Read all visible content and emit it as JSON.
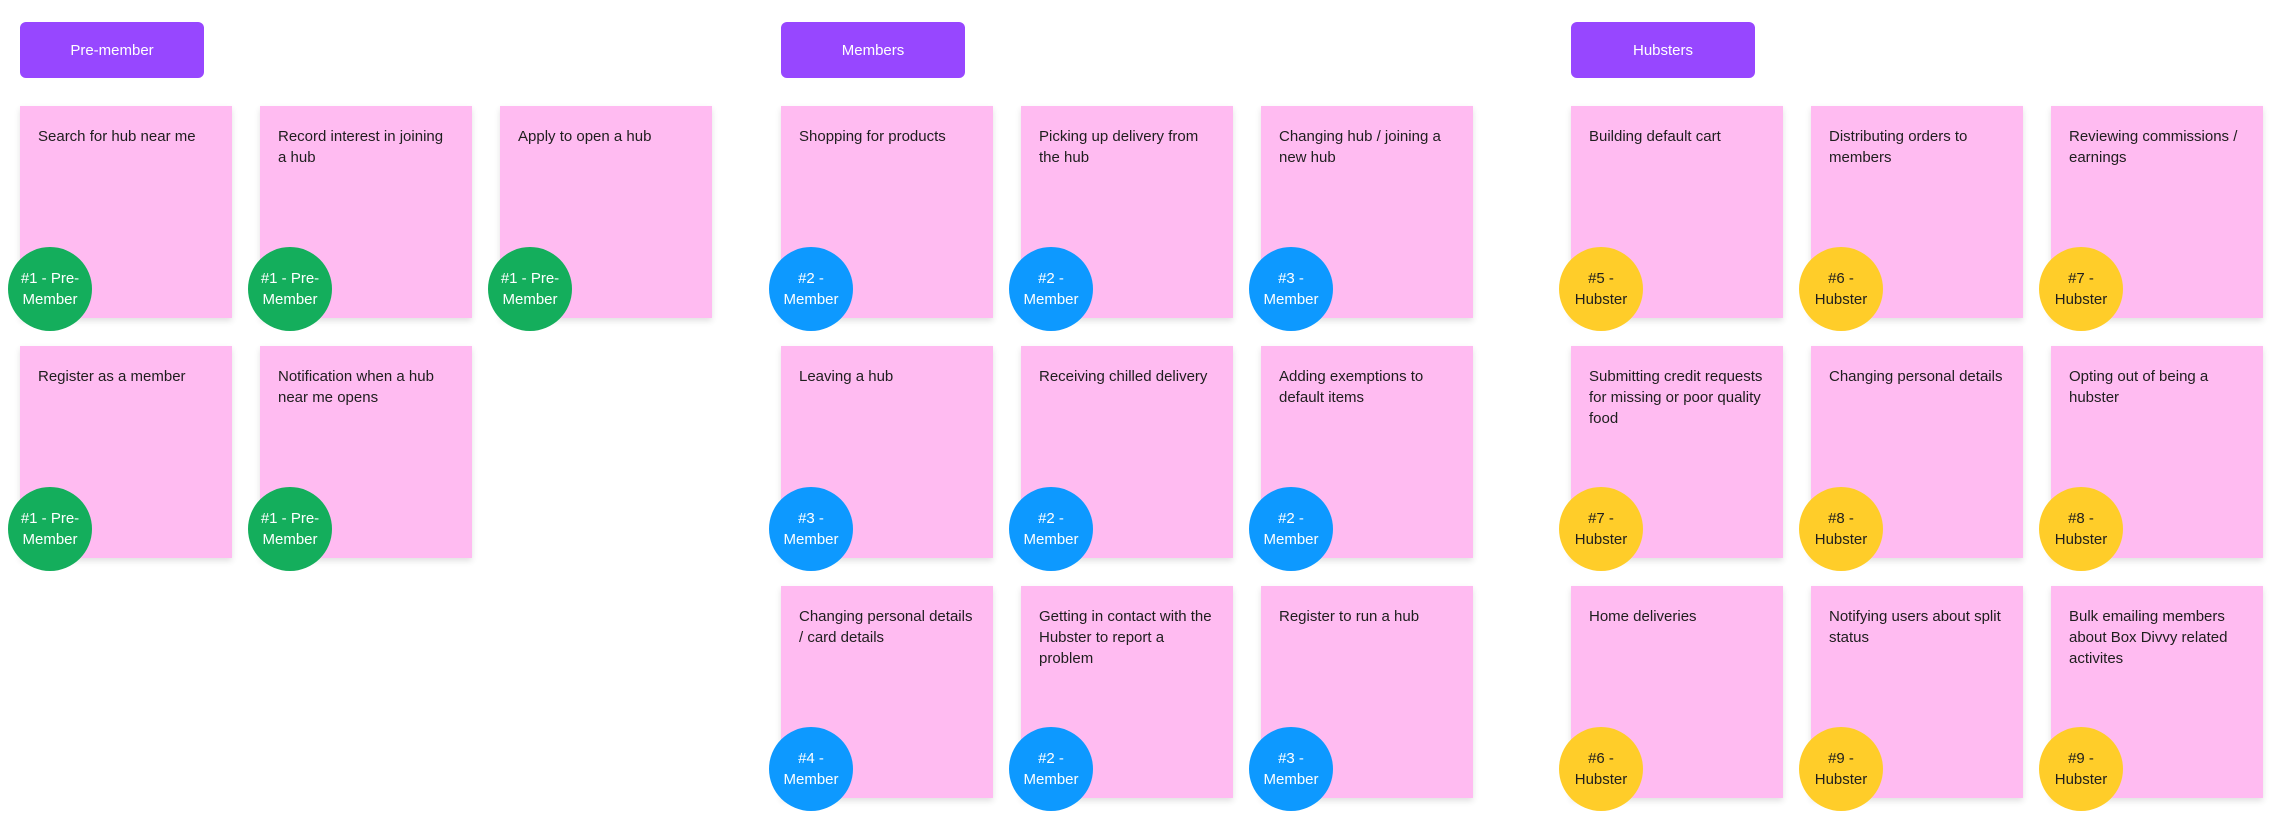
{
  "colors": {
    "header": "#9747FF",
    "sticky": "#FFBBF1",
    "pre_member": "#14AE5C",
    "member": "#0D99FF",
    "hubster": "#FFCD29"
  },
  "groups": [
    {
      "title": "Pre-member",
      "badge_color": "#14AE5C",
      "badge_text_color": "#ffffff",
      "rows": [
        [
          {
            "text": "Search for hub near me",
            "badge": "#1 - Pre-Member"
          },
          {
            "text": "Record interest in joining a hub",
            "badge": "#1 - Pre-Member"
          },
          {
            "text": "Apply to open a hub",
            "badge": "#1 - Pre-Member"
          }
        ],
        [
          {
            "text": "Register as a member",
            "badge": "#1 - Pre-Member"
          },
          {
            "text": "Notification when a hub near me opens",
            "badge": "#1 - Pre-Member"
          }
        ]
      ]
    },
    {
      "title": "Members",
      "badge_color": "#0D99FF",
      "badge_text_color": "#ffffff",
      "rows": [
        [
          {
            "text": "Shopping for products",
            "badge": "#2 - Member"
          },
          {
            "text": "Picking up delivery from the hub",
            "badge": "#2 - Member"
          },
          {
            "text": "Changing hub / joining a new hub",
            "badge": "#3 - Member"
          }
        ],
        [
          {
            "text": "Leaving a hub",
            "badge": "#3 - Member"
          },
          {
            "text": "Receiving chilled delivery",
            "badge": "#2 - Member"
          },
          {
            "text": "Adding exemptions to default items",
            "badge": "#2 - Member"
          }
        ],
        [
          {
            "text": "Changing personal details / card details",
            "badge": "#4 - Member"
          },
          {
            "text": "Getting in contact with the Hubster to report a problem",
            "badge": "#2 - Member"
          },
          {
            "text": "Register to run a hub",
            "badge": "#3 - Member"
          }
        ]
      ]
    },
    {
      "title": "Hubsters",
      "badge_color": "#FFCD29",
      "badge_text_color": "#1e1e1e",
      "rows": [
        [
          {
            "text": "Building default cart",
            "badge": "#5 - Hubster"
          },
          {
            "text": "Distributing orders to members",
            "badge": "#6 - Hubster"
          },
          {
            "text": "Reviewing commissions / earnings",
            "badge": "#7 - Hubster"
          }
        ],
        [
          {
            "text": "Submitting credit requests for missing or poor quality food",
            "badge": "#7 - Hubster"
          },
          {
            "text": "Changing personal details",
            "badge": "#8 - Hubster"
          },
          {
            "text": "Opting out of being a hubster",
            "badge": "#8 - Hubster"
          }
        ],
        [
          {
            "text": "Home deliveries",
            "badge": "#6 - Hubster"
          },
          {
            "text": "Notifying users about split status",
            "badge": "#9 - Hubster"
          },
          {
            "text": "Bulk emailing members about Box Divvy related activites",
            "badge": "#9 - Hubster"
          }
        ]
      ]
    }
  ]
}
